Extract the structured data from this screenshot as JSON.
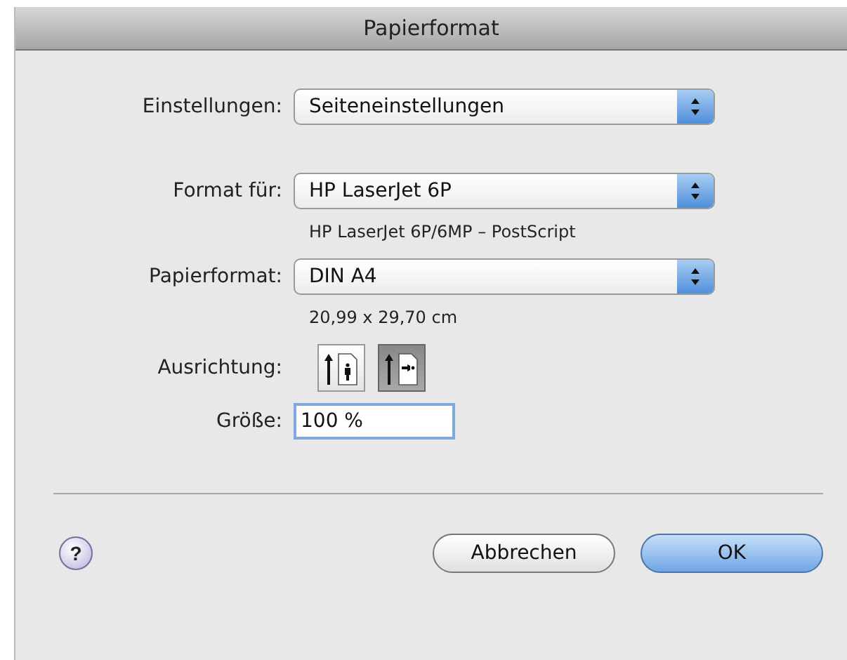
{
  "window": {
    "title": "Papierformat"
  },
  "rows": [
    {
      "kind": "popup",
      "label": "Einstellungen:",
      "value": "Seiteneinstellungen"
    },
    {
      "kind": "popup",
      "label": "Format für:",
      "value": "HP LaserJet 6P"
    },
    {
      "kind": "note",
      "value": "HP LaserJet 6P/6MP – PostScript"
    },
    {
      "kind": "popup",
      "label": "Papierformat:",
      "value": "DIN A4"
    },
    {
      "kind": "note",
      "value": "20,99 x 29,70 cm"
    },
    {
      "kind": "orientation",
      "label": "Ausrichtung:",
      "options": [
        {
          "kind": "portrait",
          "selected": false
        },
        {
          "kind": "landscape",
          "selected": true
        }
      ]
    },
    {
      "kind": "field",
      "label": "Größe:",
      "value": "100 %"
    }
  ],
  "buttons": [
    {
      "kind": "help",
      "label": "?"
    },
    {
      "kind": "cancel",
      "label": "Abbrechen"
    },
    {
      "kind": "default",
      "label": "OK"
    }
  ]
}
